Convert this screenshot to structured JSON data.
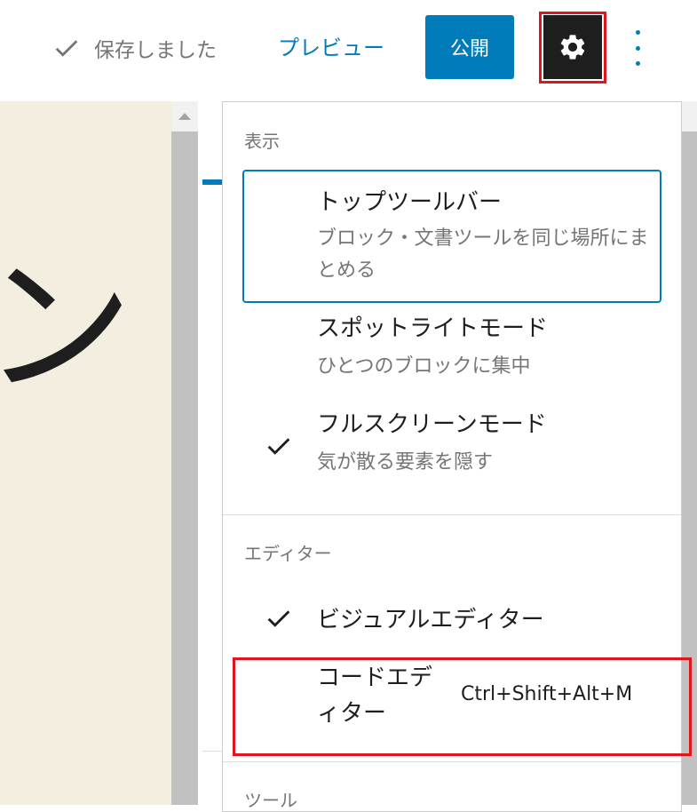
{
  "header": {
    "saved_label": "保存しました",
    "preview_label": "プレビュー",
    "publish_label": "公開"
  },
  "canvas": {
    "visible_glyph": "ン"
  },
  "menu": {
    "view_section_label": "表示",
    "editor_section_label": "エディター",
    "tools_section_label": "ツール",
    "top_toolbar": {
      "title": "トップツールバー",
      "description": "ブロック・文書ツールを同じ場所にまとめる"
    },
    "spotlight": {
      "title": "スポットライトモード",
      "description": "ひとつのブロックに集中"
    },
    "fullscreen": {
      "title": "フルスクリーンモード",
      "description": "気が散る要素を隠す",
      "checked": true
    },
    "visual_editor": {
      "title": "ビジュアルエディター",
      "checked": true
    },
    "code_editor": {
      "title": "コードエディター",
      "shortcut": "Ctrl+Shift+Alt+M"
    }
  },
  "colors": {
    "accent": "#007cba",
    "highlight": "#e0141e",
    "canvas_bg": "#f4eee0",
    "text": "#1e1e1e",
    "muted": "#757575"
  }
}
